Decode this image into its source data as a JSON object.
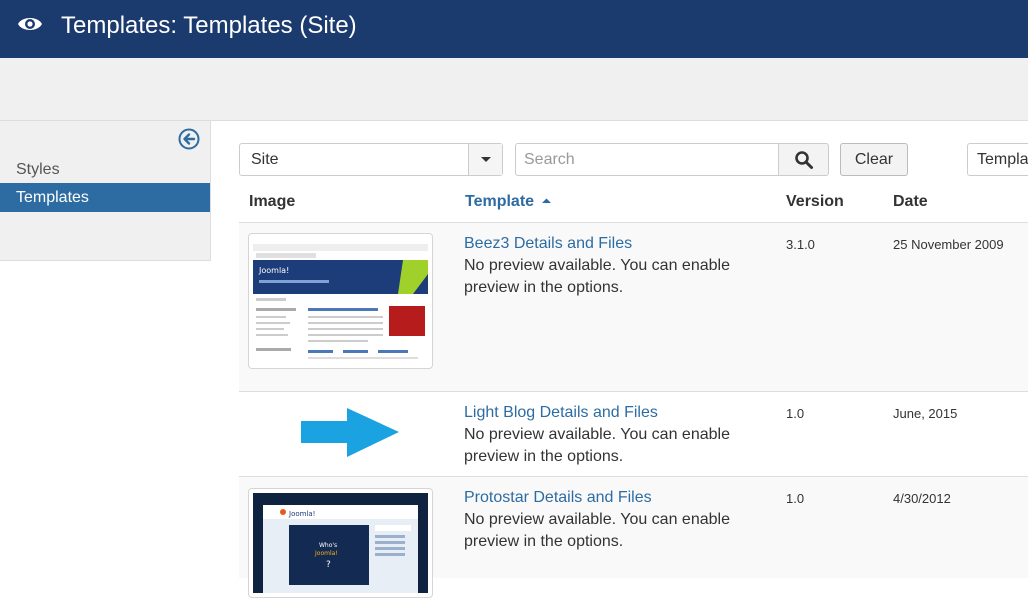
{
  "header": {
    "title": "Templates: Templates (Site)",
    "icon": "eye-icon"
  },
  "sidebar": {
    "items": [
      {
        "label": "Styles",
        "active": false
      },
      {
        "label": "Templates",
        "active": true
      }
    ]
  },
  "filters": {
    "client_select": "Site",
    "search_placeholder": "Search",
    "clear_label": "Clear",
    "sort_select": "Templa"
  },
  "table": {
    "headers": {
      "image": "Image",
      "template": "Template",
      "version": "Version",
      "date": "Date"
    },
    "rows": [
      {
        "name": "Beez3 Details and Files",
        "desc_line1": "No preview available. You can enable",
        "desc_line2": "preview in the options.",
        "version": "3.1.0",
        "date": "25 November 2009"
      },
      {
        "name": "Light Blog Details and Files",
        "desc_line1": "No preview available. You can enable",
        "desc_line2": "preview in the options.",
        "version": "1.0",
        "date": "June, 2015"
      },
      {
        "name": "Protostar Details and Files",
        "desc_line1": "No preview available. You can enable",
        "desc_line2": "preview in the options.",
        "version": "1.0",
        "date": "4/30/2012"
      }
    ]
  },
  "colors": {
    "header_bg": "#1b3b6f",
    "accent": "#2d6ca2",
    "arrow": "#1aa3e0"
  }
}
